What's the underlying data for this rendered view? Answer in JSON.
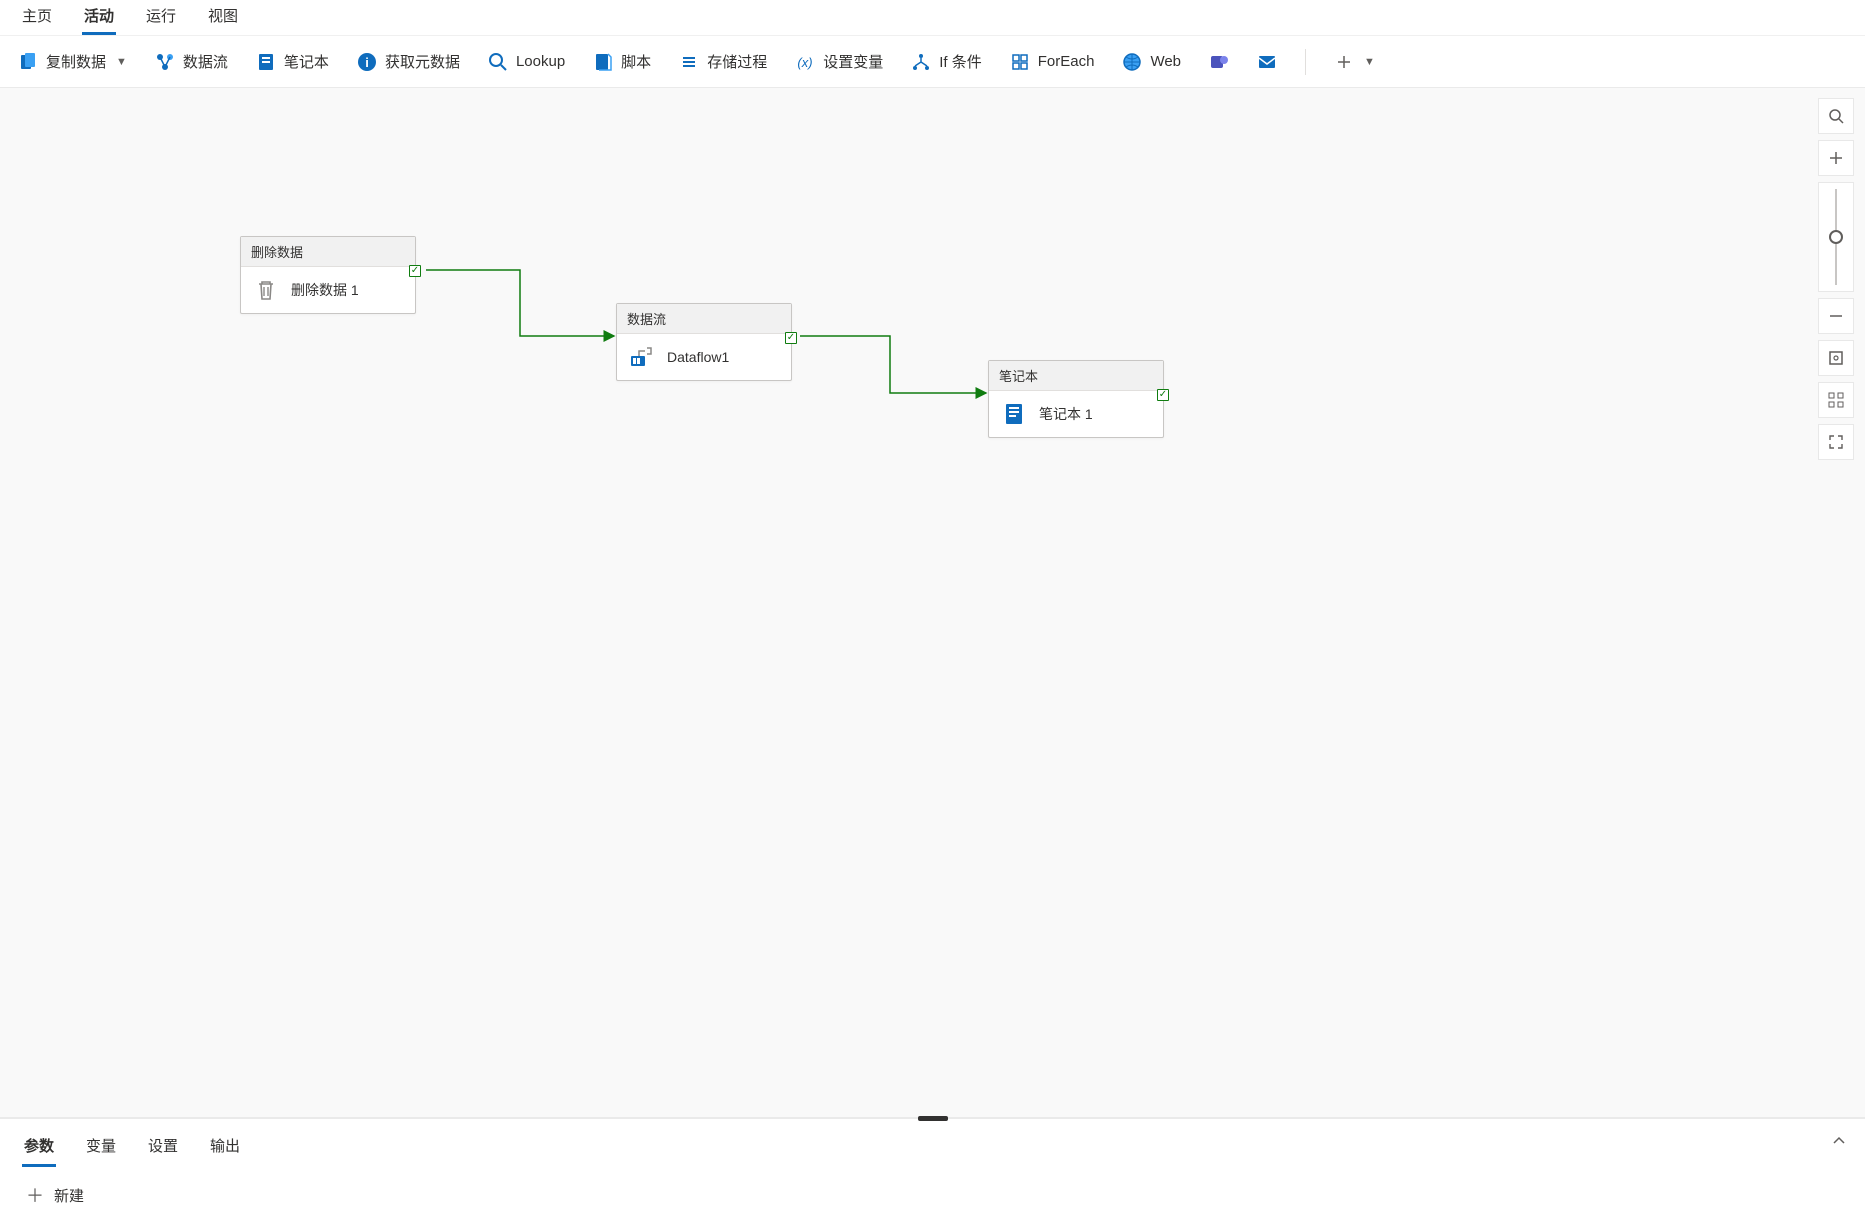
{
  "top_tabs": {
    "home": "主页",
    "activities": "活动",
    "run": "运行",
    "view": "视图",
    "active": "activities"
  },
  "toolbar": {
    "copy_data": "复制数据",
    "dataflow": "数据流",
    "notebook": "笔记本",
    "get_metadata": "获取元数据",
    "lookup": "Lookup",
    "script": "脚本",
    "stored_proc": "存储过程",
    "set_variable": "设置变量",
    "if_condition": "If 条件",
    "foreach": "ForEach",
    "web": "Web"
  },
  "nodes": {
    "delete": {
      "type_label": "删除数据",
      "name": "删除数据 1"
    },
    "dataflow": {
      "type_label": "数据流",
      "name": "Dataflow1"
    },
    "notebook": {
      "type_label": "笔记本",
      "name": "笔记本 1"
    }
  },
  "bottom_tabs": {
    "params": "参数",
    "variables": "变量",
    "settings": "设置",
    "output": "输出",
    "active": "params"
  },
  "bottom_actions": {
    "new": "新建"
  }
}
